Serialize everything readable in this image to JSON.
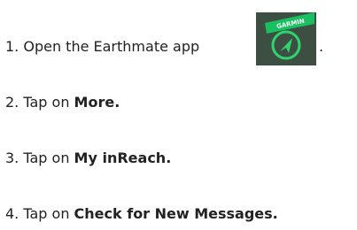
{
  "steps": [
    {
      "prefix": "1. Open the Earthmate app",
      "bold": "",
      "suffix": "."
    },
    {
      "prefix": "2. Tap on ",
      "bold": "More.",
      "suffix": ""
    },
    {
      "prefix": "3. Tap on ",
      "bold": "My inReach.",
      "suffix": ""
    },
    {
      "prefix": "4. Tap on ",
      "bold": "Check for New Messages.",
      "suffix": ""
    }
  ],
  "app_icon": {
    "name": "earthmate-app-icon",
    "brand_text": "GARMIN",
    "colors": {
      "background": "#3d4f43",
      "banner": "#18c05f",
      "ring": "#2fd46f",
      "arrow": "#2fd46f",
      "banner_text": "#ffffff"
    }
  }
}
